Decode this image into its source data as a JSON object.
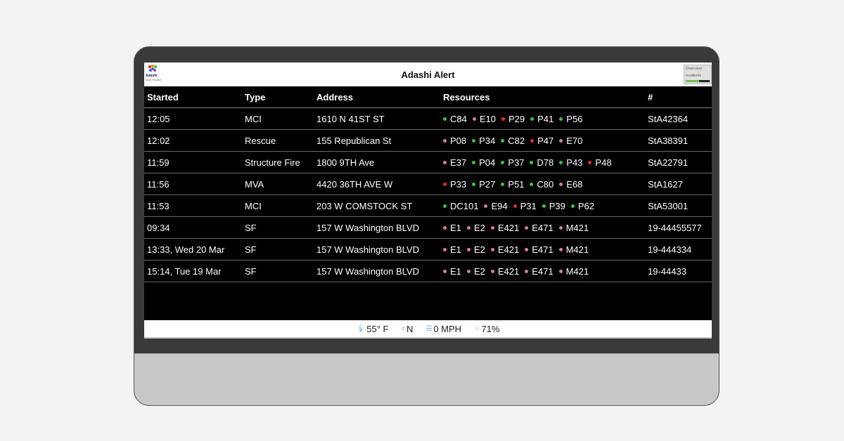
{
  "app": {
    "title": "Adashi Alert",
    "logo_name": "Adashi",
    "logo_sub": "Main Station"
  },
  "nav": {
    "items": [
      "Overview",
      "Incidents"
    ]
  },
  "colors": {
    "green": "#2ecc40",
    "red": "#e8283a",
    "pink": "#e07a9a"
  },
  "table": {
    "headers": [
      "Started",
      "Type",
      "Address",
      "Resources",
      "#"
    ],
    "rows": [
      {
        "started": "12:05",
        "type": "MCI",
        "address": "1610 N 41ST ST",
        "num": "StA42364",
        "resources": [
          {
            "name": "C84",
            "status": "green"
          },
          {
            "name": "E10",
            "status": "pink"
          },
          {
            "name": "P29",
            "status": "red"
          },
          {
            "name": "P41",
            "status": "green"
          },
          {
            "name": "P56",
            "status": "green"
          }
        ]
      },
      {
        "started": "12:02",
        "type": "Rescue",
        "address": "155 Republican St",
        "num": "StA38391",
        "resources": [
          {
            "name": "P08",
            "status": "pink"
          },
          {
            "name": "P34",
            "status": "green"
          },
          {
            "name": "C82",
            "status": "green"
          },
          {
            "name": "P47",
            "status": "red"
          },
          {
            "name": "E70",
            "status": "pink"
          }
        ]
      },
      {
        "started": "11:59",
        "type": "Structure Fire",
        "address": "1800 9TH Ave",
        "num": "StA22791",
        "resources": [
          {
            "name": "E37",
            "status": "pink"
          },
          {
            "name": "P04",
            "status": "green"
          },
          {
            "name": "P37",
            "status": "green"
          },
          {
            "name": "D78",
            "status": "green"
          },
          {
            "name": "P43",
            "status": "green"
          },
          {
            "name": "P48",
            "status": "red"
          }
        ]
      },
      {
        "started": "11:56",
        "type": "MVA",
        "address": "4420 36TH AVE W",
        "num": "StA1627",
        "resources": [
          {
            "name": "P33",
            "status": "red"
          },
          {
            "name": "P27",
            "status": "green"
          },
          {
            "name": "P51",
            "status": "green"
          },
          {
            "name": "C80",
            "status": "green"
          },
          {
            "name": "E68",
            "status": "pink"
          }
        ]
      },
      {
        "started": "11:53",
        "type": "MCI",
        "address": "203 W COMSTOCK ST",
        "num": "StA53001",
        "resources": [
          {
            "name": "DC101",
            "status": "green"
          },
          {
            "name": "E94",
            "status": "pink"
          },
          {
            "name": "P31",
            "status": "red"
          },
          {
            "name": "P39",
            "status": "green"
          },
          {
            "name": "P62",
            "status": "green"
          }
        ]
      },
      {
        "started": "09:34",
        "type": "SF",
        "address": "157 W Washington BLVD",
        "num": "19-44455577",
        "resources": [
          {
            "name": "E1",
            "status": "pink"
          },
          {
            "name": "E2",
            "status": "pink"
          },
          {
            "name": "E421",
            "status": "pink"
          },
          {
            "name": "E471",
            "status": "pink"
          },
          {
            "name": "M421",
            "status": "pink"
          }
        ]
      },
      {
        "started": "13:33, Wed 20 Mar",
        "type": "SF",
        "address": "157 W Washington BLVD",
        "num": "19-444334",
        "resources": [
          {
            "name": "E1",
            "status": "pink"
          },
          {
            "name": "E2",
            "status": "pink"
          },
          {
            "name": "E421",
            "status": "pink"
          },
          {
            "name": "E471",
            "status": "pink"
          },
          {
            "name": "M421",
            "status": "pink"
          }
        ]
      },
      {
        "started": "15:14, Tue 19 Mar",
        "type": "SF",
        "address": "157 W Washington BLVD",
        "num": "19-44433",
        "resources": [
          {
            "name": "E1",
            "status": "pink"
          },
          {
            "name": "E2",
            "status": "pink"
          },
          {
            "name": "E421",
            "status": "pink"
          },
          {
            "name": "E471",
            "status": "pink"
          },
          {
            "name": "M421",
            "status": "pink"
          }
        ]
      }
    ]
  },
  "weather": {
    "temperature": "55° F",
    "wind_direction": "N",
    "wind_speed": "0 MPH",
    "humidity": "71%"
  }
}
